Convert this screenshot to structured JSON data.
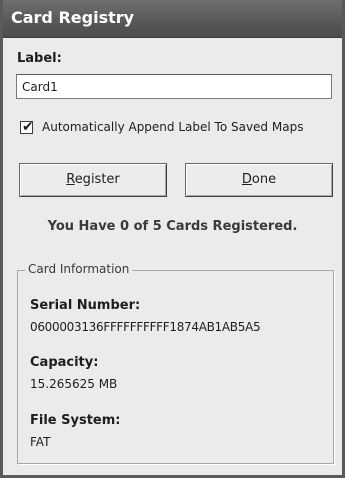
{
  "window": {
    "title": "Card Registry"
  },
  "label_section": {
    "heading": "Label:",
    "input_value": "Card1"
  },
  "options": {
    "auto_append_label": "Automatically Append Label To Saved Maps",
    "auto_append_checked": true,
    "check_glyph": "✔"
  },
  "buttons": {
    "register_mnemonic": "R",
    "register_rest": "egister",
    "done_mnemonic": "D",
    "done_rest": "one"
  },
  "status": {
    "registered_text": "You Have 0 of 5 Cards Registered."
  },
  "card_information": {
    "group_title": "Card Information",
    "serial_label": "Serial Number:",
    "serial_value": "0600003136FFFFFFFFFF1874AB1AB5A5",
    "capacity_label": "Capacity:",
    "capacity_value": "15.265625 MB",
    "file_system_label": "File System:",
    "file_system_value": "FAT"
  }
}
